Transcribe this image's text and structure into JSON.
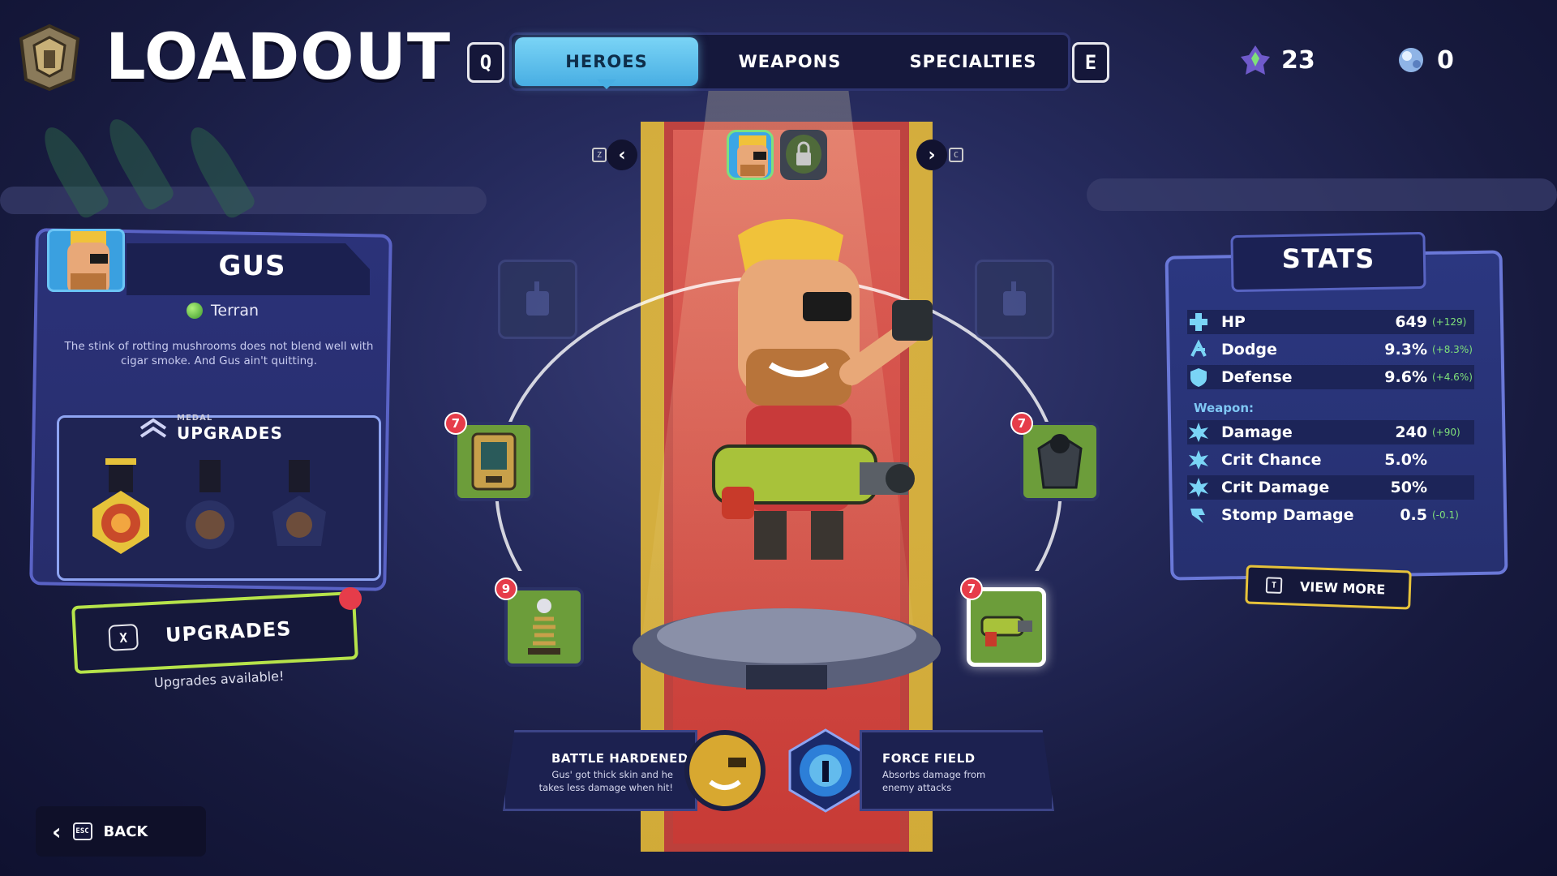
{
  "header": {
    "title": "LOADOUT",
    "prev_tab_key": "Q",
    "next_tab_key": "E",
    "tabs": [
      {
        "label": "HEROES",
        "active": true
      },
      {
        "label": "WEAPONS",
        "active": false
      },
      {
        "label": "SPECIALTIES",
        "active": false
      }
    ],
    "currency_primary": "23",
    "currency_secondary": "0"
  },
  "hero_selector": {
    "prev_key": "Z",
    "next_key": "C",
    "heroes": [
      {
        "name": "Gus",
        "selected": true,
        "locked": false
      },
      {
        "name": "Locked hero",
        "selected": false,
        "locked": true
      }
    ]
  },
  "hero": {
    "name": "GUS",
    "race": "Terran",
    "bio": "The stink of rotting mushrooms does not blend well with cigar smoke. And Gus ain't quitting.",
    "medal_caption": "MEDAL",
    "medal_title": "UPGRADES",
    "medals": [
      {
        "state": "unlocked"
      },
      {
        "state": "locked"
      },
      {
        "state": "locked"
      }
    ],
    "upgrades_button": {
      "key": "X",
      "label": "UPGRADES"
    },
    "upgrades_note": "Upgrades available!"
  },
  "equipment": {
    "slots": [
      {
        "id": "top-left",
        "state": "empty",
        "level": ""
      },
      {
        "id": "top-right",
        "state": "empty",
        "level": ""
      },
      {
        "id": "mid-left",
        "state": "filled",
        "level": "7",
        "icon": "device-icon"
      },
      {
        "id": "mid-right",
        "state": "filled",
        "level": "7",
        "icon": "armor-icon"
      },
      {
        "id": "low-left",
        "state": "filled",
        "level": "9",
        "icon": "spring-icon"
      },
      {
        "id": "low-right",
        "state": "selected",
        "level": "7",
        "icon": "blaster-icon"
      }
    ]
  },
  "abilities": [
    {
      "name": "BATTLE HARDENED",
      "desc": "Gus' got thick skin and he takes less damage when hit!"
    },
    {
      "name": "FORCE FIELD",
      "desc": "Absorbs damage from enemy attacks"
    }
  ],
  "stats": {
    "title": "STATS",
    "hero_stats": [
      {
        "label": "HP",
        "value": "649",
        "bonus": "(+129)"
      },
      {
        "label": "Dodge",
        "value": "9.3%",
        "bonus": "(+8.3%)"
      },
      {
        "label": "Defense",
        "value": "9.6%",
        "bonus": "(+4.6%)"
      }
    ],
    "weapon_heading": "Weapon:",
    "weapon_stats": [
      {
        "label": "Damage",
        "value": "240",
        "bonus": "(+90)"
      },
      {
        "label": "Crit Chance",
        "value": "5.0%",
        "bonus": ""
      },
      {
        "label": "Crit Damage",
        "value": "50%",
        "bonus": ""
      },
      {
        "label": "Stomp Damage",
        "value": "0.5",
        "bonus": "(-0.1)"
      }
    ],
    "view_more": {
      "key": "T",
      "label": "VIEW MORE"
    }
  },
  "footer": {
    "back_key": "ESC",
    "back_label": "BACK"
  },
  "colors": {
    "accent_tab": "#48aee3",
    "upgrade_border": "#b6e34a",
    "notification": "#e63c4a",
    "bonus_green": "#7fe07a",
    "view_more_border": "#e6c23a"
  }
}
